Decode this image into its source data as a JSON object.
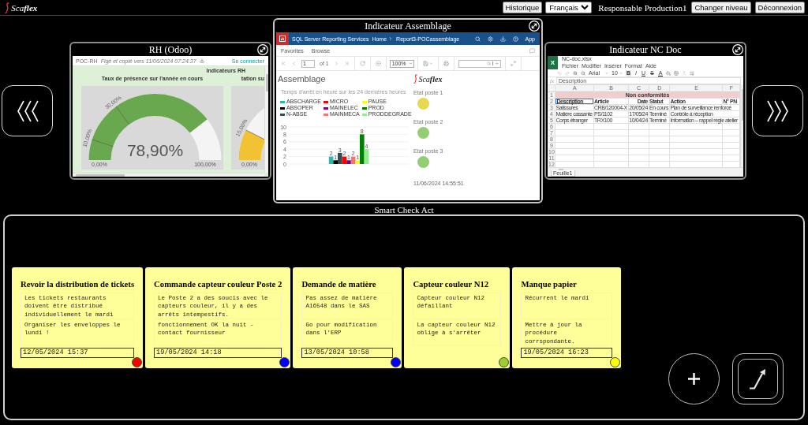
{
  "top_bar": {
    "logo": "Sca**flex**",
    "history_button": "Historique",
    "language": "Français",
    "user": "Responsable Production1",
    "level_button": "Changer niveau",
    "logout_button": "Déconnexion"
  },
  "carousel": {
    "panels": [
      {
        "kind": "dashboard",
        "title": "RH (Odoo)",
        "selected": false,
        "app": {
          "tag": "POC-RH",
          "snapshot": "Figé et copié vers 11/06/2024 07:24:37",
          "login": "Se connecter",
          "heading": "Indicateurs RH",
          "gauges": [
            {
              "title": "Taux de présence sur l'année en cours",
              "value": "78,90%",
              "color": "#6aa84f",
              "min": "0,00%",
              "max": "100,00%",
              "ticks": [
                "10,00%",
                "30,00%"
              ]
            },
            {
              "title": "tation su",
              "level": 0.15,
              "color": "#f1c232",
              "min": "0,00%",
              "ticks": [
                "15,00%"
              ]
            }
          ]
        }
      },
      {
        "kind": "report",
        "title": "Indicateur Assemblage",
        "selected": true,
        "app": {
          "brand": "SQL Server Reporting Services",
          "breadcrumb": [
            "Home",
            "Report3-POCassemblage"
          ],
          "user": "App",
          "nav": [
            "Favorites",
            "Browse"
          ],
          "page": "1",
          "page_count": "of 1",
          "zoom": "100%",
          "report_title": "Assemblage",
          "logo": "Sca**flex**",
          "chart_data": {
            "type": "bar",
            "title": "Temps d'arrêt en heure sur les 24 dernières heures",
            "series": [
              {
                "name": "ABSCHARGE",
                "color": "#1fbfb0",
                "values": [
                  2
                ]
              },
              {
                "name": "ABSOPER",
                "color": "#000000",
                "values": [
                  1
                ]
              },
              {
                "name": "N-ABSE",
                "color": "#3b4a50",
                "values": [
                  3
                ]
              },
              {
                "name": "MICRO",
                "color": "#ff0000",
                "values": [
                  2
                ]
              },
              {
                "name": "MAINELEC",
                "color": "#800080",
                "values": [
                  1
                ]
              },
              {
                "name": "MAINMECA",
                "color": "#ff6f6f",
                "values": [
                  2
                ]
              },
              {
                "name": "PAUSE",
                "color": "#ffff00",
                "values": [
                  1
                ]
              },
              {
                "name": "PROD",
                "color": "#008000",
                "values": [
                  8
                ]
              },
              {
                "name": "PRODDEGRADE",
                "color": "#90ee90",
                "values": [
                  4
                ]
              }
            ],
            "ylim": [
              0,
              10
            ],
            "yticks": [
              0,
              2,
              4,
              6,
              8,
              10
            ],
            "grid": true,
            "data_labels": true
          },
          "stations": [
            {
              "label": "Etat poste 1",
              "color": "#e6d84f"
            },
            {
              "label": "Etat poste 2",
              "color": "#93cf72"
            },
            {
              "label": "Etat poste 3",
              "color": "#93cf72"
            }
          ],
          "timestamp": "11/06/2024 14:55:51"
        }
      },
      {
        "kind": "sheet",
        "title": "Indicateur NC Doc",
        "selected": false,
        "app": {
          "badge": "X",
          "file": "NC-doc.xlsx",
          "menu": [
            "Fichier",
            "Modifier",
            "Insérer",
            "Format",
            "Aide"
          ],
          "font": "Arial",
          "font_size": "10",
          "style_buttons": [
            {
              "kind": "bold",
              "label": "B"
            },
            {
              "kind": "italic",
              "label": "I"
            },
            {
              "kind": "underline",
              "label": "U"
            },
            {
              "kind": "strike",
              "label": "S"
            },
            {
              "kind": "color",
              "label": "A"
            }
          ],
          "fx": "fx",
          "formula": "Description",
          "columns": [
            "A",
            "B",
            "C",
            "D",
            "E",
            "F"
          ],
          "row_numbers": [
            "1",
            "2",
            "3",
            "4",
            "5",
            "6",
            "7",
            "8",
            "9",
            "10",
            "11",
            "12"
          ],
          "banner": "Non conformités",
          "headers": [
            {
              "label": "Description",
              "kind": "text",
              "selected": true
            },
            {
              "label": "Article",
              "kind": "text",
              "selected": false
            },
            {
              "label": "Date",
              "kind": "date",
              "selected": false
            },
            {
              "label": "Statut",
              "kind": "text",
              "selected": false
            },
            {
              "label": "Action",
              "kind": "text",
              "selected": false
            },
            {
              "label": "N° PN",
              "kind": "text",
              "selected": false
            }
          ],
          "rows": [
            [
              "Salissures",
              "CRB/120004-X",
              "20/05/24",
              "En cours",
              "Plan de surveillance renforcé"
            ],
            [
              "Matière cassante",
              "PS/1102",
              "17/05/24",
              "Terminé",
              "Contrôle à réception"
            ],
            [
              "Corps étranger",
              "TRX100",
              "10/04/24",
              "Terminé",
              "Information – rappel règle atelier"
            ]
          ],
          "tab": "Feuille1"
        }
      }
    ]
  },
  "smart_check": {
    "title": "Smart Check Act",
    "cards": [
      {
        "title": "Revoir la distribution de tickets",
        "description": "Les tickets restaurants doivent être distribué individuellement le mardi",
        "action": "Organiser les enveloppes le lundi !",
        "date": "12/05/2024 15:37",
        "color": "#ff0000"
      },
      {
        "title": "Commande capteur couleur Poste 2",
        "description": "Le Poste 2 a des soucis avec le capteurs couleur, il y a des arrêts intempestifs.",
        "action": "fonctionnement OK la nuit - contact fournisseur",
        "date": "19/05/2024 14:18",
        "color": "#0000ff"
      },
      {
        "title": "Demande de matière",
        "description": "Pas assez de matière A16548 dans le SAS",
        "action": "Go pour modification dans l'ERP",
        "date": "13/05/2024 10:58",
        "color": "#0000ff"
      },
      {
        "title": "Capteur couleur N12",
        "description": "Capteur couleur N12 défaillant",
        "action": "La capteur couleur N12 oblige à s'arrêter",
        "color": "#9acd32"
      },
      {
        "title": "Manque papier",
        "description": "Récurrent le mardi",
        "action": "Mettre à jour la procédure corrspondante.",
        "date": "19/05/2024 16:23",
        "color": "#ffff00"
      }
    ]
  }
}
